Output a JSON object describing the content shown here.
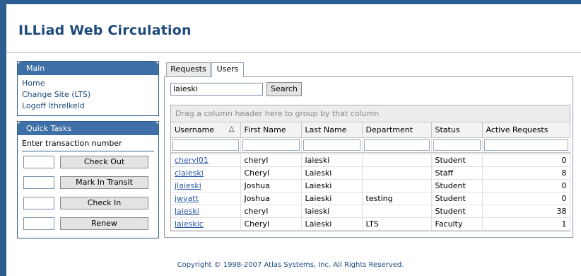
{
  "header": {
    "title": "ILLiad Web Circulation"
  },
  "main_box": {
    "title": "Main",
    "links": [
      "Home",
      "Change Site (LTS)",
      "Logoff lthrelkeld"
    ]
  },
  "quick_tasks": {
    "title": "Quick Tasks",
    "label": "Enter transaction number",
    "buttons": [
      "Check Out",
      "Mark In Transit",
      "Check In",
      "Renew"
    ]
  },
  "tabs": [
    "Requests",
    "Users"
  ],
  "active_tab": "Users",
  "search": {
    "value": "laieski",
    "button": "Search"
  },
  "grid": {
    "group_hint": "Drag a column header here to group by that column",
    "columns": [
      "Username",
      "First Name",
      "Last Name",
      "Department",
      "Status",
      "Active Requests"
    ],
    "sorted_column": "Username",
    "sort_icon": "sort-ascending-icon",
    "rows": [
      [
        "cheryl01",
        "cheryl",
        "laieski",
        "",
        "Student",
        "0"
      ],
      [
        "claieski",
        "Cheryl",
        "Laieski",
        "",
        "Staff",
        "8"
      ],
      [
        "jlaieski",
        "Joshua",
        "Laieski",
        "",
        "Student",
        "0"
      ],
      [
        "jwyatt",
        "Joshua",
        "Laieski",
        "testing",
        "Student",
        "0"
      ],
      [
        "laieski",
        "cheryl",
        "laieski",
        "",
        "Student",
        "38"
      ],
      [
        "laieskic",
        "Cheryl",
        "Laieski",
        "LTS",
        "Faculty",
        "1"
      ]
    ]
  },
  "footer": "Copyright © 1998-2007 Atlas Systems, Inc. All Rights Reserved.",
  "colors": {
    "brand": "#2d5c8f",
    "title": "#1e4a7c",
    "link": "#2a56a8"
  }
}
